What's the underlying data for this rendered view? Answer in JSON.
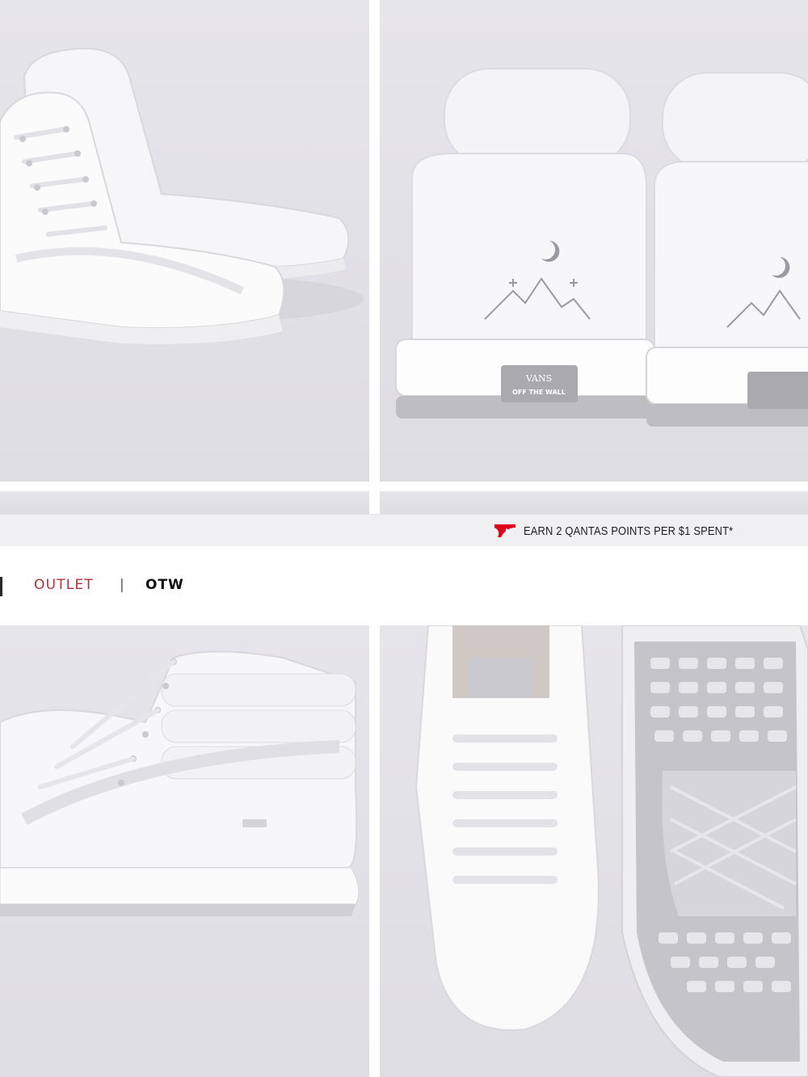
{
  "gallery": {
    "images": [
      {
        "alt": "White high-top sneakers, pair side view"
      },
      {
        "alt": "White high-top sneakers, heel view with moon and mountain graphic"
      },
      {
        "alt": "White high-top sneaker, side profile"
      },
      {
        "alt": "White high-top sneaker top view and outsole waffle pattern"
      }
    ],
    "heel_logo_line1": "VANS",
    "heel_logo_line2": "OFF THE WALL"
  },
  "promo": {
    "icon": "qantas-kangaroo-icon",
    "text": "EARN 2 QANTAS POINTS PER $1 SPENT*",
    "icon_color": "#e0001b"
  },
  "nav": {
    "items": [
      {
        "label": "OUTLET",
        "color": "#b0313a"
      },
      {
        "label": "OTW",
        "color": "#111111"
      }
    ],
    "separator": "|"
  }
}
